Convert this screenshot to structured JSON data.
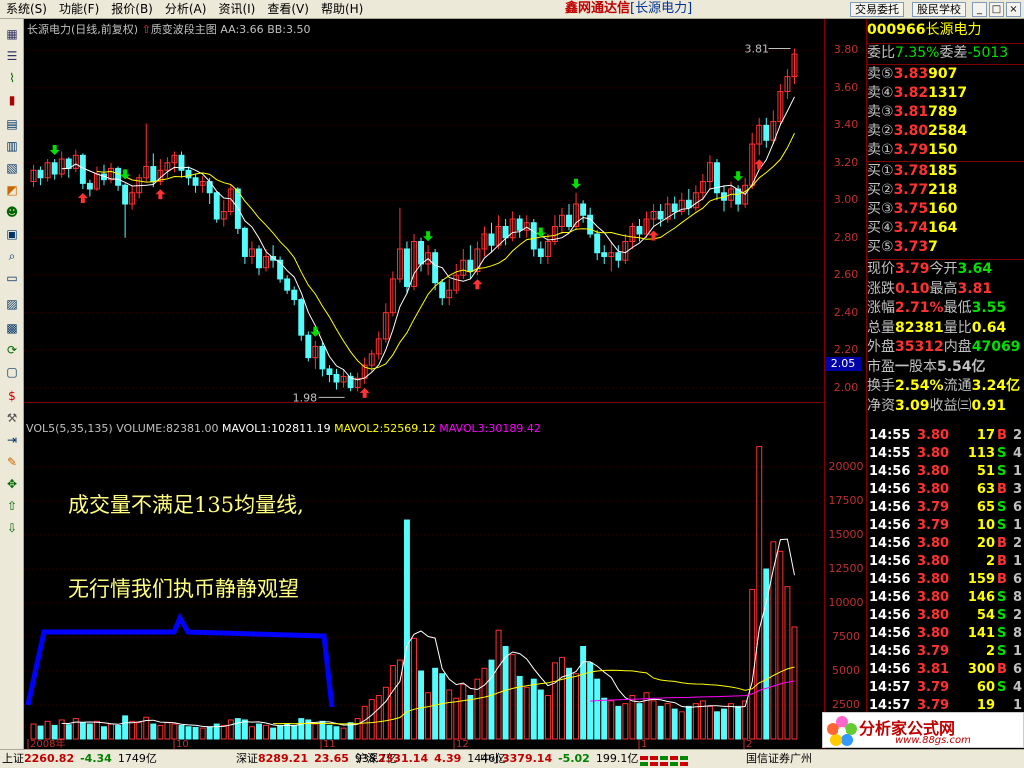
{
  "menu": [
    "系统(S)",
    "功能(F)",
    "报价(B)",
    "分析(A)",
    "资讯(I)",
    "查看(V)",
    "帮助(H)"
  ],
  "app_title": {
    "brand": "鑫网通达信",
    "stock": "[长源电力]"
  },
  "top_buttons": {
    "trade": "交易委托",
    "school": "股民学校"
  },
  "window_buttons": [
    "_",
    "□",
    "×"
  ],
  "colors": {
    "up": "#ff3232",
    "down": "#54fcfc",
    "ma1": "#ffffff",
    "ma2": "#ffff00",
    "ma3": "#ff00ff",
    "bg": "#000000",
    "grid": "#800000",
    "annotation": "#ffff80",
    "box": "#0000ff"
  },
  "chart_header": {
    "name": "长源电力(日线,前复权)",
    "indicator": "质变波段主图",
    "aa": "AA:3.66",
    "bb": "BB:3.50"
  },
  "price_axis": [
    "3.80",
    "3.60",
    "3.40",
    "3.20",
    "3.00",
    "2.80",
    "2.60",
    "2.40",
    "2.20",
    "2.00"
  ],
  "current_price_tag": "2.05",
  "marks": {
    "high": "3.81",
    "low": "1.98"
  },
  "volume_header": {
    "vol": "VOL5(5,35,135)",
    "volume": "VOLUME:82381.00",
    "mavol1": "MAVOL1:102811.19",
    "mavol2": "MAVOL2:52569.12",
    "mavol3": "MAVOL3:30189.42"
  },
  "volume_axis": [
    "20000",
    "17500",
    "15000",
    "12500",
    "10000",
    "7500",
    "5000",
    "2500"
  ],
  "date_axis": [
    "2008年",
    "10",
    "11",
    "12",
    "1",
    "2"
  ],
  "annotations": [
    "成交量不满足135均量线,",
    "无行情我们执币静静观望"
  ],
  "chart_data": {
    "type": "candlestick",
    "series": [
      {
        "name": "MAVOL1",
        "color": "#ffffff"
      },
      {
        "name": "MAVOL2",
        "color": "#ffff00"
      },
      {
        "name": "MAVOL3",
        "color": "#ff00ff"
      }
    ],
    "price_ylim": [
      1.95,
      3.85
    ],
    "volume_ylim": [
      0,
      22500
    ],
    "candles": [
      {
        "o": 3.1,
        "c": 3.16,
        "h": 3.19,
        "l": 3.07,
        "v": 1100
      },
      {
        "o": 3.16,
        "c": 3.12,
        "h": 3.18,
        "l": 3.08,
        "v": 950
      },
      {
        "o": 3.12,
        "c": 3.2,
        "h": 3.22,
        "l": 3.1,
        "v": 1300
      },
      {
        "o": 3.2,
        "c": 3.14,
        "h": 3.22,
        "l": 3.11,
        "v": 1000
      },
      {
        "o": 3.14,
        "c": 3.22,
        "h": 3.26,
        "l": 3.12,
        "v": 1400
      },
      {
        "o": 3.22,
        "c": 3.17,
        "h": 3.23,
        "l": 3.12,
        "v": 1050
      },
      {
        "o": 3.17,
        "c": 3.24,
        "h": 3.27,
        "l": 3.15,
        "v": 1500
      },
      {
        "o": 3.24,
        "c": 3.09,
        "h": 3.25,
        "l": 3.06,
        "v": 1200
      },
      {
        "o": 3.09,
        "c": 3.06,
        "h": 3.11,
        "l": 3.02,
        "v": 1100
      },
      {
        "o": 3.06,
        "c": 3.14,
        "h": 3.18,
        "l": 3.05,
        "v": 1300
      },
      {
        "o": 3.14,
        "c": 3.11,
        "h": 3.19,
        "l": 3.08,
        "v": 900
      },
      {
        "o": 3.11,
        "c": 3.17,
        "h": 3.2,
        "l": 3.09,
        "v": 1100
      },
      {
        "o": 3.17,
        "c": 3.08,
        "h": 3.18,
        "l": 3.05,
        "v": 1000
      },
      {
        "o": 3.08,
        "c": 2.98,
        "h": 3.09,
        "l": 2.8,
        "v": 1700
      },
      {
        "o": 2.98,
        "c": 3.04,
        "h": 3.08,
        "l": 2.95,
        "v": 1300
      },
      {
        "o": 3.04,
        "c": 3.12,
        "h": 3.14,
        "l": 3.01,
        "v": 1200
      },
      {
        "o": 3.12,
        "c": 3.18,
        "h": 3.41,
        "l": 3.1,
        "v": 1600
      },
      {
        "o": 3.18,
        "c": 3.1,
        "h": 3.25,
        "l": 3.07,
        "v": 1100
      },
      {
        "o": 3.1,
        "c": 3.16,
        "h": 3.22,
        "l": 3.08,
        "v": 1000
      },
      {
        "o": 3.16,
        "c": 3.2,
        "h": 3.23,
        "l": 3.12,
        "v": 1200
      },
      {
        "o": 3.2,
        "c": 3.24,
        "h": 3.26,
        "l": 3.15,
        "v": 1100
      },
      {
        "o": 3.24,
        "c": 3.16,
        "h": 3.26,
        "l": 3.12,
        "v": 1000
      },
      {
        "o": 3.16,
        "c": 3.12,
        "h": 3.18,
        "l": 3.08,
        "v": 900
      },
      {
        "o": 3.12,
        "c": 3.08,
        "h": 3.14,
        "l": 3.04,
        "v": 850
      },
      {
        "o": 3.08,
        "c": 3.1,
        "h": 3.13,
        "l": 3.04,
        "v": 800
      },
      {
        "o": 3.1,
        "c": 3.04,
        "h": 3.12,
        "l": 2.98,
        "v": 900
      },
      {
        "o": 3.04,
        "c": 2.9,
        "h": 3.05,
        "l": 2.88,
        "v": 1100
      },
      {
        "o": 2.9,
        "c": 2.94,
        "h": 3.0,
        "l": 2.86,
        "v": 1000
      },
      {
        "o": 2.94,
        "c": 3.06,
        "h": 3.08,
        "l": 2.92,
        "v": 1400
      },
      {
        "o": 3.06,
        "c": 2.85,
        "h": 3.07,
        "l": 2.82,
        "v": 1500
      },
      {
        "o": 2.85,
        "c": 2.7,
        "h": 2.86,
        "l": 2.66,
        "v": 1400
      },
      {
        "o": 2.7,
        "c": 2.74,
        "h": 2.78,
        "l": 2.66,
        "v": 900
      },
      {
        "o": 2.74,
        "c": 2.64,
        "h": 2.76,
        "l": 2.6,
        "v": 1100
      },
      {
        "o": 2.64,
        "c": 2.7,
        "h": 2.74,
        "l": 2.62,
        "v": 1000
      },
      {
        "o": 2.7,
        "c": 2.68,
        "h": 2.76,
        "l": 2.64,
        "v": 800
      },
      {
        "o": 2.68,
        "c": 2.58,
        "h": 2.7,
        "l": 2.56,
        "v": 1000
      },
      {
        "o": 2.58,
        "c": 2.52,
        "h": 2.6,
        "l": 2.5,
        "v": 1100
      },
      {
        "o": 2.52,
        "c": 2.47,
        "h": 2.54,
        "l": 2.44,
        "v": 1000
      },
      {
        "o": 2.47,
        "c": 2.28,
        "h": 2.48,
        "l": 2.25,
        "v": 1500
      },
      {
        "o": 2.28,
        "c": 2.16,
        "h": 2.3,
        "l": 2.14,
        "v": 1400
      },
      {
        "o": 2.16,
        "c": 2.22,
        "h": 2.25,
        "l": 2.1,
        "v": 1100
      },
      {
        "o": 2.22,
        "c": 2.1,
        "h": 2.24,
        "l": 2.06,
        "v": 1300
      },
      {
        "o": 2.1,
        "c": 2.07,
        "h": 2.12,
        "l": 2.03,
        "v": 1000
      },
      {
        "o": 2.07,
        "c": 2.03,
        "h": 2.1,
        "l": 1.99,
        "v": 900
      },
      {
        "o": 2.03,
        "c": 2.06,
        "h": 2.1,
        "l": 2.0,
        "v": 800
      },
      {
        "o": 2.06,
        "c": 2.0,
        "h": 2.08,
        "l": 1.98,
        "v": 1200
      },
      {
        "o": 2.0,
        "c": 2.05,
        "h": 2.08,
        "l": 1.98,
        "v": 1500
      },
      {
        "o": 2.05,
        "c": 2.12,
        "h": 2.16,
        "l": 2.02,
        "v": 2400
      },
      {
        "o": 2.12,
        "c": 2.18,
        "h": 2.2,
        "l": 2.08,
        "v": 2900
      },
      {
        "o": 2.18,
        "c": 2.26,
        "h": 2.3,
        "l": 2.15,
        "v": 3200
      },
      {
        "o": 2.26,
        "c": 2.4,
        "h": 2.45,
        "l": 2.24,
        "v": 3800
      },
      {
        "o": 2.4,
        "c": 2.58,
        "h": 2.62,
        "l": 2.38,
        "v": 5400
      },
      {
        "o": 2.58,
        "c": 2.74,
        "h": 2.96,
        "l": 2.56,
        "v": 5800
      },
      {
        "o": 2.74,
        "c": 2.54,
        "h": 2.78,
        "l": 2.5,
        "v": 16100
      },
      {
        "o": 2.54,
        "c": 2.78,
        "h": 2.82,
        "l": 2.52,
        "v": 7400
      },
      {
        "o": 2.78,
        "c": 2.66,
        "h": 2.8,
        "l": 2.62,
        "v": 5000
      },
      {
        "o": 2.66,
        "c": 2.72,
        "h": 2.76,
        "l": 2.6,
        "v": 3400
      },
      {
        "o": 2.72,
        "c": 2.56,
        "h": 2.74,
        "l": 2.52,
        "v": 5200
      },
      {
        "o": 2.56,
        "c": 2.48,
        "h": 2.58,
        "l": 2.44,
        "v": 4800
      },
      {
        "o": 2.48,
        "c": 2.52,
        "h": 2.58,
        "l": 2.44,
        "v": 3600
      },
      {
        "o": 2.52,
        "c": 2.6,
        "h": 2.66,
        "l": 2.5,
        "v": 3000
      },
      {
        "o": 2.6,
        "c": 2.68,
        "h": 2.74,
        "l": 2.58,
        "v": 4000
      },
      {
        "o": 2.68,
        "c": 2.62,
        "h": 2.76,
        "l": 2.58,
        "v": 3200
      },
      {
        "o": 2.62,
        "c": 2.74,
        "h": 2.78,
        "l": 2.6,
        "v": 4400
      },
      {
        "o": 2.74,
        "c": 2.82,
        "h": 2.86,
        "l": 2.7,
        "v": 5200
      },
      {
        "o": 2.82,
        "c": 2.76,
        "h": 2.88,
        "l": 2.72,
        "v": 5800
      },
      {
        "o": 2.76,
        "c": 2.86,
        "h": 2.92,
        "l": 2.74,
        "v": 8000
      },
      {
        "o": 2.86,
        "c": 2.8,
        "h": 2.9,
        "l": 2.76,
        "v": 6800
      },
      {
        "o": 2.8,
        "c": 2.9,
        "h": 2.94,
        "l": 2.78,
        "v": 6200
      },
      {
        "o": 2.9,
        "c": 2.84,
        "h": 2.92,
        "l": 2.8,
        "v": 4600
      },
      {
        "o": 2.84,
        "c": 2.88,
        "h": 2.92,
        "l": 2.8,
        "v": 3800
      },
      {
        "o": 2.88,
        "c": 2.74,
        "h": 2.9,
        "l": 2.7,
        "v": 4400
      },
      {
        "o": 2.74,
        "c": 2.7,
        "h": 2.78,
        "l": 2.66,
        "v": 3600
      },
      {
        "o": 2.7,
        "c": 2.78,
        "h": 2.82,
        "l": 2.66,
        "v": 3200
      },
      {
        "o": 2.78,
        "c": 2.86,
        "h": 2.92,
        "l": 2.76,
        "v": 5600
      },
      {
        "o": 2.86,
        "c": 2.92,
        "h": 2.96,
        "l": 2.82,
        "v": 6000
      },
      {
        "o": 2.92,
        "c": 2.86,
        "h": 2.98,
        "l": 2.84,
        "v": 5200
      },
      {
        "o": 2.86,
        "c": 2.98,
        "h": 3.04,
        "l": 2.84,
        "v": 4800
      },
      {
        "o": 2.98,
        "c": 2.92,
        "h": 3.0,
        "l": 2.88,
        "v": 6800
      },
      {
        "o": 2.92,
        "c": 2.82,
        "h": 2.96,
        "l": 2.8,
        "v": 5600
      },
      {
        "o": 2.82,
        "c": 2.72,
        "h": 2.84,
        "l": 2.68,
        "v": 4400
      },
      {
        "o": 2.72,
        "c": 2.7,
        "h": 2.76,
        "l": 2.66,
        "v": 3000
      },
      {
        "o": 2.7,
        "c": 2.72,
        "h": 2.78,
        "l": 2.62,
        "v": 2800
      },
      {
        "o": 2.72,
        "c": 2.68,
        "h": 2.76,
        "l": 2.64,
        "v": 2400
      },
      {
        "o": 2.68,
        "c": 2.78,
        "h": 2.82,
        "l": 2.66,
        "v": 2600
      },
      {
        "o": 2.78,
        "c": 2.86,
        "h": 2.88,
        "l": 2.74,
        "v": 3200
      },
      {
        "o": 2.86,
        "c": 2.82,
        "h": 2.9,
        "l": 2.78,
        "v": 2600
      },
      {
        "o": 2.82,
        "c": 2.9,
        "h": 2.94,
        "l": 2.8,
        "v": 3400
      },
      {
        "o": 2.9,
        "c": 2.94,
        "h": 2.98,
        "l": 2.86,
        "v": 2800
      },
      {
        "o": 2.94,
        "c": 2.9,
        "h": 2.98,
        "l": 2.86,
        "v": 2400
      },
      {
        "o": 2.9,
        "c": 2.98,
        "h": 3.02,
        "l": 2.88,
        "v": 2600
      },
      {
        "o": 2.98,
        "c": 2.94,
        "h": 3.02,
        "l": 2.9,
        "v": 2200
      },
      {
        "o": 2.94,
        "c": 3.0,
        "h": 3.04,
        "l": 2.92,
        "v": 2000
      },
      {
        "o": 3.0,
        "c": 2.96,
        "h": 3.06,
        "l": 2.92,
        "v": 2400
      },
      {
        "o": 2.96,
        "c": 3.04,
        "h": 3.08,
        "l": 2.94,
        "v": 2600
      },
      {
        "o": 3.04,
        "c": 3.1,
        "h": 3.14,
        "l": 3.0,
        "v": 2800
      },
      {
        "o": 3.1,
        "c": 3.2,
        "h": 3.24,
        "l": 3.06,
        "v": 2400
      },
      {
        "o": 3.2,
        "c": 3.04,
        "h": 3.22,
        "l": 3.0,
        "v": 2000
      },
      {
        "o": 3.04,
        "c": 3.0,
        "h": 3.08,
        "l": 2.94,
        "v": 2200
      },
      {
        "o": 3.0,
        "c": 3.06,
        "h": 3.1,
        "l": 2.96,
        "v": 2600
      },
      {
        "o": 3.06,
        "c": 2.98,
        "h": 3.08,
        "l": 2.94,
        "v": 2400
      },
      {
        "o": 2.98,
        "c": 3.08,
        "h": 3.12,
        "l": 2.96,
        "v": 2800
      },
      {
        "o": 3.08,
        "c": 3.3,
        "h": 3.36,
        "l": 3.06,
        "v": 11000
      },
      {
        "o": 3.3,
        "c": 3.4,
        "h": 3.44,
        "l": 3.24,
        "v": 21500
      },
      {
        "o": 3.4,
        "c": 3.32,
        "h": 3.44,
        "l": 3.28,
        "v": 12500
      },
      {
        "o": 3.32,
        "c": 3.42,
        "h": 3.48,
        "l": 3.3,
        "v": 14500
      },
      {
        "o": 3.42,
        "c": 3.58,
        "h": 3.62,
        "l": 3.4,
        "v": 13800
      },
      {
        "o": 3.58,
        "c": 3.66,
        "h": 3.7,
        "l": 3.54,
        "v": 11200
      },
      {
        "o": 3.66,
        "c": 3.78,
        "h": 3.81,
        "l": 3.62,
        "v": 8238
      }
    ]
  },
  "quote": {
    "code": "000966",
    "name": "长源电力",
    "ratio_label": "委比",
    "ratio": "7.35%",
    "diff_label": "委差",
    "diff": "-5013",
    "sells": [
      {
        "label": "卖⑤",
        "price": "3.83",
        "vol": "907"
      },
      {
        "label": "卖④",
        "price": "3.82",
        "vol": "1317"
      },
      {
        "label": "卖③",
        "price": "3.81",
        "vol": "789"
      },
      {
        "label": "卖②",
        "price": "3.80",
        "vol": "2584"
      },
      {
        "label": "卖①",
        "price": "3.79",
        "vol": "150"
      }
    ],
    "buys": [
      {
        "label": "买①",
        "price": "3.78",
        "vol": "185"
      },
      {
        "label": "买②",
        "price": "3.77",
        "vol": "218"
      },
      {
        "label": "买③",
        "price": "3.75",
        "vol": "160"
      },
      {
        "label": "买④",
        "price": "3.74",
        "vol": "164"
      },
      {
        "label": "买⑤",
        "price": "3.73",
        "vol": "7"
      }
    ],
    "stats": [
      {
        "l1": "现价",
        "v1": "3.79",
        "c1": "#ff3232",
        "l2": "今开",
        "v2": "3.64",
        "c2": "#00e000"
      },
      {
        "l1": "涨跌",
        "v1": "0.10",
        "c1": "#ff3232",
        "l2": "最高",
        "v2": "3.81",
        "c2": "#ff3232"
      },
      {
        "l1": "涨幅",
        "v1": "2.71%",
        "c1": "#ff3232",
        "l2": "最低",
        "v2": "3.55",
        "c2": "#00e000"
      },
      {
        "l1": "总量",
        "v1": "82381",
        "c1": "#ffff00",
        "l2": "量比",
        "v2": "0.64",
        "c2": "#ffff00"
      },
      {
        "l1": "外盘",
        "v1": "35312",
        "c1": "#ff3232",
        "l2": "内盘",
        "v2": "47069",
        "c2": "#00e000"
      },
      {
        "l1": "市盈",
        "v1": "一",
        "c1": "#c0c0c0",
        "l2": "股本",
        "v2": "5.54亿",
        "c2": "#c0c0c0"
      },
      {
        "l1": "换手",
        "v1": "2.54%",
        "c1": "#ffff00",
        "l2": "流通",
        "v2": "3.24亿",
        "c2": "#ffff00"
      },
      {
        "l1": "净资",
        "v1": "3.09",
        "c1": "#ffff00",
        "l2": "收益㈢",
        "v2": "0.91",
        "c2": "#ffff00"
      }
    ]
  },
  "ticks": [
    {
      "t": "14:55",
      "p": "3.80",
      "v": "17",
      "d": "B",
      "n": "2"
    },
    {
      "t": "14:55",
      "p": "3.80",
      "v": "113",
      "d": "S",
      "n": "4"
    },
    {
      "t": "14:56",
      "p": "3.80",
      "v": "51",
      "d": "S",
      "n": "1"
    },
    {
      "t": "14:56",
      "p": "3.80",
      "v": "63",
      "d": "B",
      "n": "3"
    },
    {
      "t": "14:56",
      "p": "3.79",
      "v": "65",
      "d": "S",
      "n": "6"
    },
    {
      "t": "14:56",
      "p": "3.79",
      "v": "10",
      "d": "S",
      "n": "1"
    },
    {
      "t": "14:56",
      "p": "3.80",
      "v": "20",
      "d": "B",
      "n": "2"
    },
    {
      "t": "14:56",
      "p": "3.80",
      "v": "2",
      "d": "B",
      "n": "1"
    },
    {
      "t": "14:56",
      "p": "3.80",
      "v": "159",
      "d": "B",
      "n": "6"
    },
    {
      "t": "14:56",
      "p": "3.80",
      "v": "146",
      "d": "S",
      "n": "8"
    },
    {
      "t": "14:56",
      "p": "3.80",
      "v": "54",
      "d": "S",
      "n": "2"
    },
    {
      "t": "14:56",
      "p": "3.80",
      "v": "141",
      "d": "S",
      "n": "8"
    },
    {
      "t": "14:56",
      "p": "3.79",
      "v": "2",
      "d": "S",
      "n": "1"
    },
    {
      "t": "14:56",
      "p": "3.81",
      "v": "300",
      "d": "B",
      "n": "6"
    },
    {
      "t": "14:57",
      "p": "3.79",
      "v": "60",
      "d": "S",
      "n": "4"
    },
    {
      "t": "14:57",
      "p": "3.79",
      "v": "19",
      "d": "",
      "n": "1"
    }
  ],
  "status": [
    {
      "label": "上证",
      "v1": "2260.82",
      "c1": "#c00000",
      "v2": "-4.34",
      "c2": "#008000",
      "v3": "1749亿"
    },
    {
      "label": "深证",
      "v1": "8289.21",
      "c1": "#c00000",
      "v2": "23.65",
      "c2": "#c00000",
      "v3": "938.7亿"
    },
    {
      "label": "沪深",
      "v1": "2331.14",
      "c1": "#c00000",
      "v2": "4.39",
      "c2": "#c00000",
      "v3": "1446亿"
    },
    {
      "label": "中小",
      "v1": "3379.14",
      "c1": "#c00000",
      "v2": "-5.02",
      "c2": "#008000",
      "v3": "199.1亿"
    }
  ],
  "broker": "国信证券广州",
  "watermark": {
    "name": "分析家公式网",
    "url": "www.88gs.com"
  }
}
